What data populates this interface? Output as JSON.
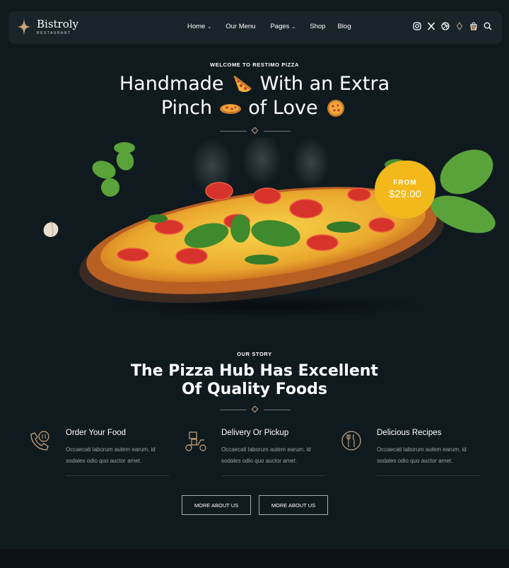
{
  "brand": {
    "name": "Bistroly",
    "tagline": "RESTAURANT",
    "accent": "#c9a37a"
  },
  "nav": {
    "items": [
      {
        "label": "Home",
        "has_dropdown": true
      },
      {
        "label": "Our Menu",
        "has_dropdown": false
      },
      {
        "label": "Pages",
        "has_dropdown": true
      },
      {
        "label": "Shop",
        "has_dropdown": false
      },
      {
        "label": "Blog",
        "has_dropdown": false
      }
    ],
    "icons": [
      "instagram-icon",
      "x-twitter-icon",
      "dribbble-icon",
      "diamond-icon",
      "cart-icon",
      "search-icon"
    ],
    "cart_count": "0"
  },
  "hero": {
    "eyebrow": "WELCOME TO RESTIMO PIZZA",
    "title_line1_a": "Handmade",
    "title_line1_b": "With an Extra",
    "title_line2_a": "Pinch",
    "title_line2_b": "of Love",
    "price_from": "FROM",
    "price": "$29.00",
    "price_color": "#f3b81a"
  },
  "story": {
    "eyebrow": "OUR STORY",
    "title_line1": "The Pizza Hub Has Excellent",
    "title_line2": "Of Quality Foods",
    "features": [
      {
        "title": "Order Your Food",
        "desc": "Occaecati laborum autem earum, id sodales odio quo auctor amet.",
        "icon": "phone-order-icon"
      },
      {
        "title": "Delivery Or Pickup",
        "desc": "Occaecati laborum autem earum, id sodales odio quo auctor amet.",
        "icon": "delivery-scooter-icon"
      },
      {
        "title": "Delicious Recipes",
        "desc": "Occaecati laborum autem earum, id sodales odio quo auctor amet.",
        "icon": "plate-cutlery-icon"
      }
    ],
    "buttons": [
      "MORE ABOUT US",
      "MORE ABOUT US"
    ]
  }
}
